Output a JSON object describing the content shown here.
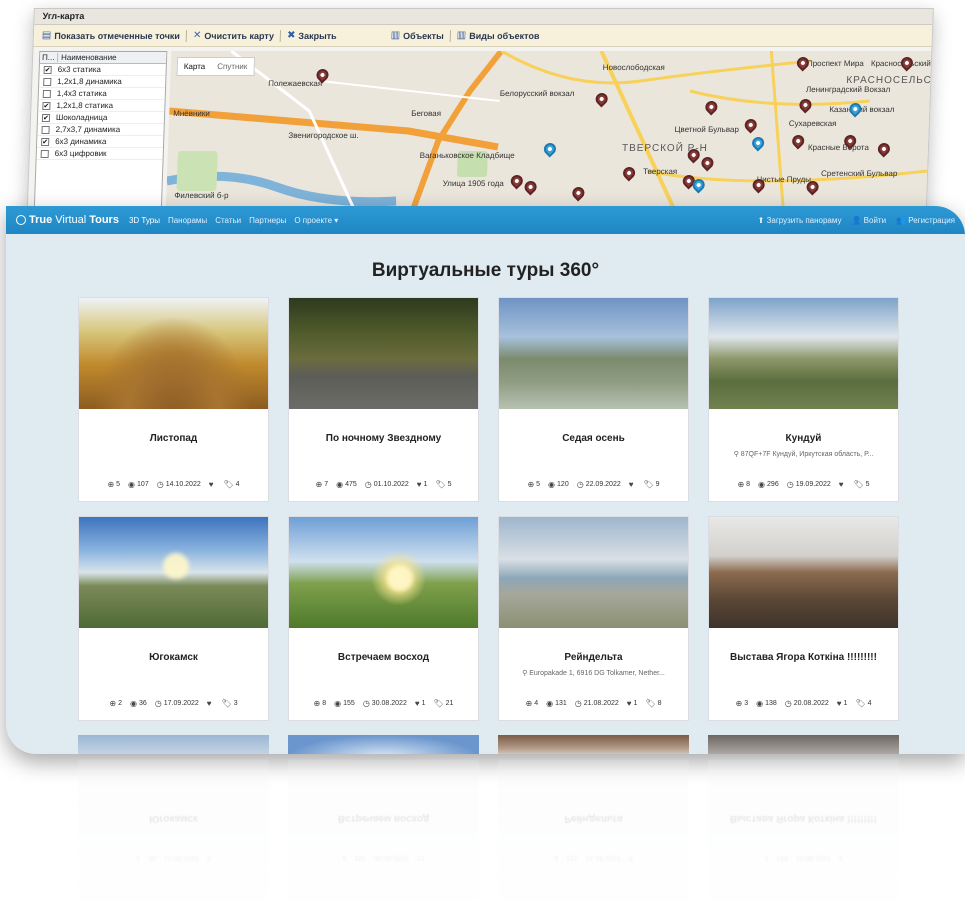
{
  "map_app": {
    "title": "Угл-карта",
    "toolbar": {
      "show_marked": "Показать отмеченные точки",
      "clear_map": "Очистить карту",
      "close": "Закрыть",
      "objects": "Объекты",
      "object_types": "Виды объектов"
    },
    "layers": {
      "col_check": "П...",
      "col_name": "Наименование",
      "items": [
        {
          "name": "6х3 статика",
          "checked": true
        },
        {
          "name": "1,2х1,8 динамика",
          "checked": false
        },
        {
          "name": "1,4х3 статика",
          "checked": false
        },
        {
          "name": "1,2х1,8 статика",
          "checked": true
        },
        {
          "name": "Шоколадница",
          "checked": true
        },
        {
          "name": "2,7х3,7 динамика",
          "checked": false
        },
        {
          "name": "6х3 динамика",
          "checked": true
        },
        {
          "name": "6х3 цифровик",
          "checked": false
        }
      ]
    },
    "map_tabs": {
      "map": "Карта",
      "satellite": "Спутник"
    },
    "map_labels": [
      "Полежаевская",
      "Новослободская",
      "Белорусский вокзал",
      "Беговая",
      "Цветной Бульвар",
      "Сухаревская",
      "Проспект Мира",
      "Красносельский",
      "Ленинградский Вокзал",
      "Казанский вокзал",
      "Красные Ворота",
      "Тверская",
      "Чистые Пруды",
      "Сретенский Бульвар",
      "Ваганьковское Кладбище",
      "Улица 1905 года",
      "Мнёвники",
      "Звенигородское ш.",
      "ТВЕРСКОЙ Р-Н",
      "КРАСНОСЕЛЬСКИЙ",
      "Филевский б-р"
    ]
  },
  "site": {
    "brand_first": "True",
    "brand_mid": "Virtual",
    "brand_last": "Tours",
    "nav": [
      "3D Туры",
      "Панорамы",
      "Статьи",
      "Партнеры",
      "О проекте ▾"
    ],
    "nav_right": [
      "Загрузить панораму",
      "Войти",
      "Регистрация"
    ],
    "page_title": "Виртуальные туры 360°",
    "tours": [
      {
        "title": "Листопад",
        "address": "",
        "panos": "5",
        "views": "107",
        "date": "14.10.2022",
        "likes": "",
        "tags": "4",
        "thumb": "t-autumn"
      },
      {
        "title": "По ночному Звездному",
        "address": "",
        "panos": "7",
        "views": "475",
        "date": "01.10.2022",
        "likes": "1",
        "tags": "5",
        "thumb": "t-night"
      },
      {
        "title": "Седая осень",
        "address": "",
        "panos": "5",
        "views": "120",
        "date": "22.09.2022",
        "likes": "",
        "tags": "9",
        "thumb": "t-frost"
      },
      {
        "title": "Кундуй",
        "address": "87QF+7F Кундуй, Иркутская область, Р...",
        "panos": "8",
        "views": "296",
        "date": "19.09.2022",
        "likes": "",
        "tags": "5",
        "thumb": "t-river"
      },
      {
        "title": "Югокамск",
        "address": "",
        "panos": "2",
        "views": "36",
        "date": "17.09.2022",
        "likes": "",
        "tags": "3",
        "thumb": "t-yugo"
      },
      {
        "title": "Встречаем восход",
        "address": "",
        "panos": "8",
        "views": "155",
        "date": "30.08.2022",
        "likes": "1",
        "tags": "21",
        "thumb": "t-sunrise"
      },
      {
        "title": "Рейндельта",
        "address": "Europakade 1, 6916 DG Tolkamer, Nether...",
        "panos": "4",
        "views": "131",
        "date": "21.08.2022",
        "likes": "1",
        "tags": "8",
        "thumb": "t-rhine"
      },
      {
        "title": "Выстава Ягора Коткіна !!!!!!!!!",
        "address": "",
        "panos": "3",
        "views": "138",
        "date": "20.08.2022",
        "likes": "1",
        "tags": "4",
        "thumb": "t-gallery"
      }
    ]
  },
  "icons": {
    "panos": "pano-icon",
    "views": "eye-icon",
    "date": "clock-icon",
    "likes": "heart-icon",
    "tags": "tags-icon"
  },
  "colors": {
    "navbar": "#1e86c3",
    "page_bg": "#dfeaf1",
    "pin_red": "#8a3b38",
    "pin_blue": "#3aa3d8",
    "road_orange": "#f5a623"
  }
}
